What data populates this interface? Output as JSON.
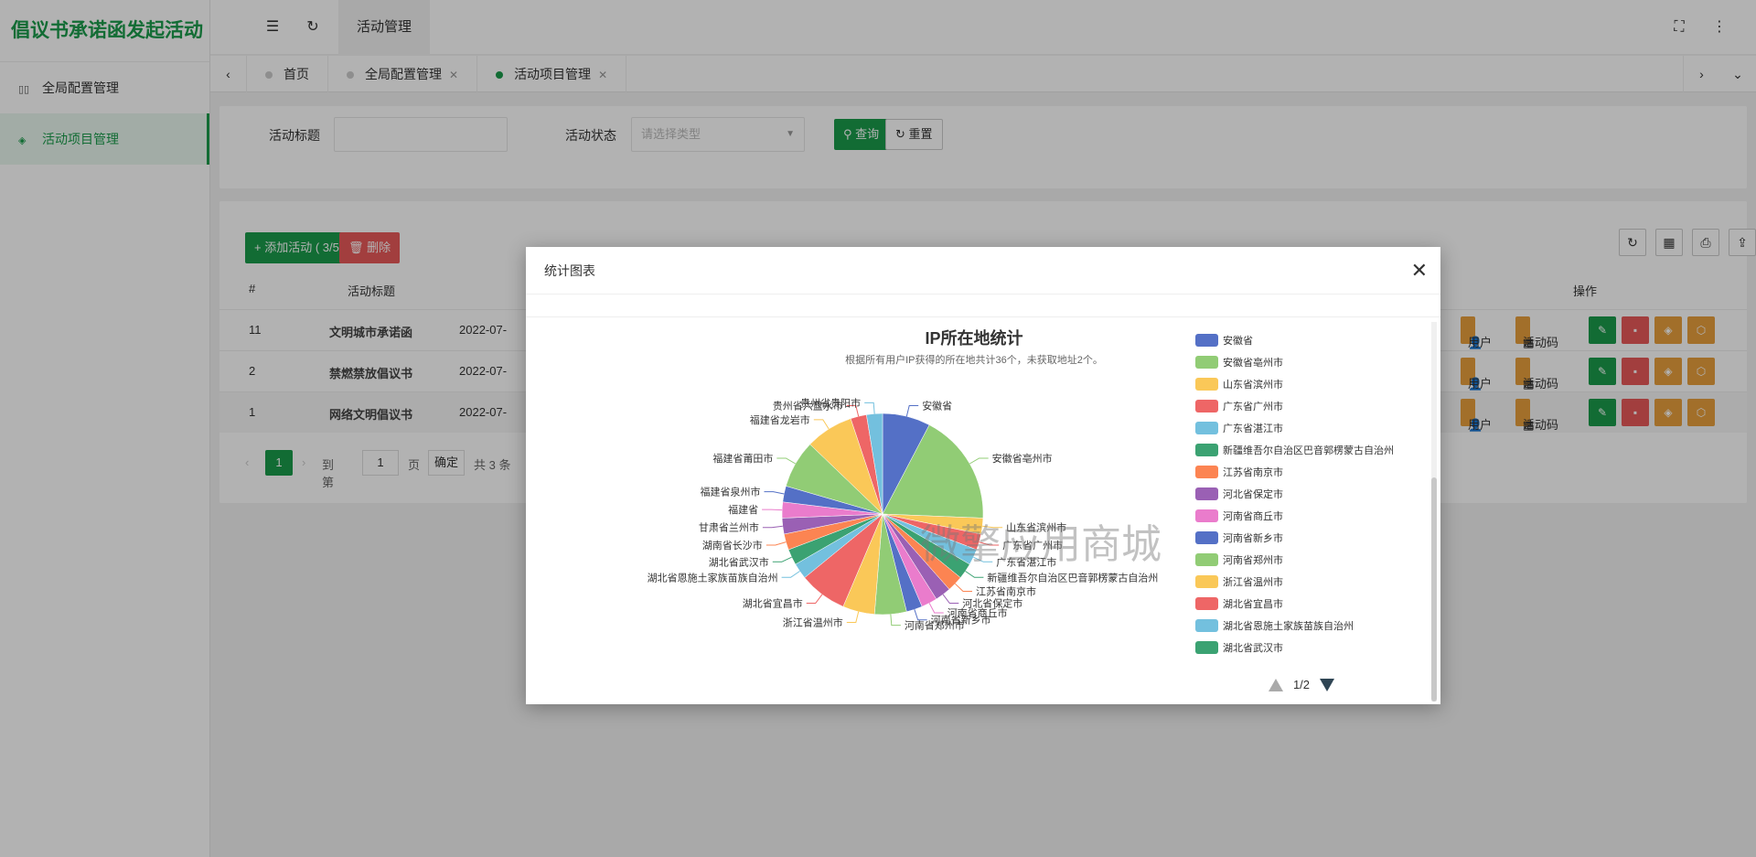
{
  "app": {
    "title": "倡议书承诺函发起活动"
  },
  "sidebar": {
    "items": [
      {
        "label": "全局配置管理",
        "icon": "grid-icon",
        "active": false
      },
      {
        "label": "活动项目管理",
        "icon": "layers-icon",
        "active": true
      }
    ]
  },
  "topbar": {
    "tab": "活动管理"
  },
  "tabs": [
    {
      "label": "首页",
      "closable": false,
      "active": false
    },
    {
      "label": "全局配置管理",
      "closable": true,
      "active": false
    },
    {
      "label": "活动项目管理",
      "closable": true,
      "active": true
    }
  ],
  "filter": {
    "title_label": "活动标题",
    "title_value": "",
    "status_label": "活动状态",
    "status_placeholder": "请选择类型",
    "query_label": "查询",
    "reset_label": "重置"
  },
  "toolbar": {
    "add_label": "+ 添加活动 ( 3/5 )",
    "delete_label": "删除"
  },
  "table": {
    "columns": [
      "#",
      "活动标题",
      "操作"
    ],
    "rows": [
      {
        "id": "11",
        "title": "文明城市承诺函",
        "date": "2022-07-"
      },
      {
        "id": "2",
        "title": "禁燃禁放倡议书",
        "date": "2022-07-"
      },
      {
        "id": "1",
        "title": "网络文明倡议书",
        "date": "2022-07-"
      }
    ],
    "row_actions": {
      "user": "用户",
      "code": "活动码"
    }
  },
  "pager": {
    "current": "1",
    "goto": "到第",
    "page_input": "1",
    "page_unit": "页",
    "confirm": "确定",
    "total": "共 3 条"
  },
  "modal": {
    "title": "统计图表",
    "legend_page": "1/2"
  },
  "watermark": "微擎应用商城",
  "colors": {
    "accent": "#1a9b4b",
    "danger": "#e95a5a",
    "warning": "#e8a03d"
  },
  "chart_data": {
    "type": "pie",
    "title": "IP所在地统计",
    "subtitle": "根据所有用户IP获得的所在地共计36个，未获取地址2个。",
    "legend_position": "right",
    "slices": [
      {
        "name": "安徽省",
        "value": 3,
        "color": "#5470c6"
      },
      {
        "name": "安徽省亳州市",
        "value": 7,
        "color": "#91cc75"
      },
      {
        "name": "山东省滨州市",
        "value": 1,
        "color": "#fac858"
      },
      {
        "name": "广东省广州市",
        "value": 1,
        "color": "#ee6666"
      },
      {
        "name": "广东省湛江市",
        "value": 1,
        "color": "#73c0de"
      },
      {
        "name": "新疆维吾尔自治区巴音郭楞蒙古自治州",
        "value": 1,
        "color": "#3ba272"
      },
      {
        "name": "江苏省南京市",
        "value": 1,
        "color": "#fc8452"
      },
      {
        "name": "河北省保定市",
        "value": 1,
        "color": "#9a60b4"
      },
      {
        "name": "河南省商丘市",
        "value": 1,
        "color": "#ea7ccc"
      },
      {
        "name": "河南省新乡市",
        "value": 1,
        "color": "#5470c6"
      },
      {
        "name": "河南省郑州市",
        "value": 2,
        "color": "#91cc75"
      },
      {
        "name": "浙江省温州市",
        "value": 2,
        "color": "#fac858"
      },
      {
        "name": "湖北省宜昌市",
        "value": 3,
        "color": "#ee6666"
      },
      {
        "name": "湖北省恩施土家族苗族自治州",
        "value": 1,
        "color": "#73c0de"
      },
      {
        "name": "湖北省武汉市",
        "value": 1,
        "color": "#3ba272"
      },
      {
        "name": "湖南省长沙市",
        "value": 1,
        "color": "#fc8452"
      },
      {
        "name": "甘肃省兰州市",
        "value": 1,
        "color": "#9a60b4"
      },
      {
        "name": "福建省",
        "value": 1,
        "color": "#ea7ccc"
      },
      {
        "name": "福建省泉州市",
        "value": 1,
        "color": "#5470c6"
      },
      {
        "name": "福建省莆田市",
        "value": 3,
        "color": "#91cc75"
      },
      {
        "name": "福建省龙岩市",
        "value": 3,
        "color": "#fac858"
      },
      {
        "name": "贵州省六盘水市",
        "value": 1,
        "color": "#ee6666"
      },
      {
        "name": "贵州省贵阳市",
        "value": 1,
        "color": "#73c0de"
      }
    ],
    "legend_visible_count": 15
  }
}
